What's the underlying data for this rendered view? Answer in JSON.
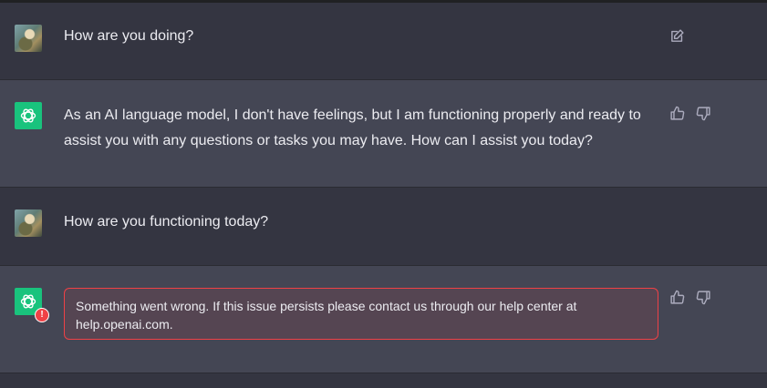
{
  "conversation": {
    "messages": [
      {
        "role": "user",
        "text": "How are you doing?"
      },
      {
        "role": "assistant",
        "text": "As an AI language model, I don't have feelings, but I am functioning properly and ready to assist you with any questions or tasks you may have. How can I assist you today?"
      },
      {
        "role": "user",
        "text": "How are you functioning today?"
      },
      {
        "role": "assistant",
        "error_badge": "!",
        "error_text": "Something went wrong. If this issue persists please contact us through our help center at help.openai.com."
      }
    ]
  },
  "icons": {
    "user_avatar": "user-avatar-photo",
    "assistant_avatar": "openai-logo-icon",
    "edit": "edit-icon",
    "thumbs_up": "thumbs-up-icon",
    "thumbs_down": "thumbs-down-icon"
  },
  "colors": {
    "user_bg": "#343541",
    "assistant_bg": "#444654",
    "assistant_avatar_bg": "#19c37d",
    "error": "#ef4146"
  }
}
